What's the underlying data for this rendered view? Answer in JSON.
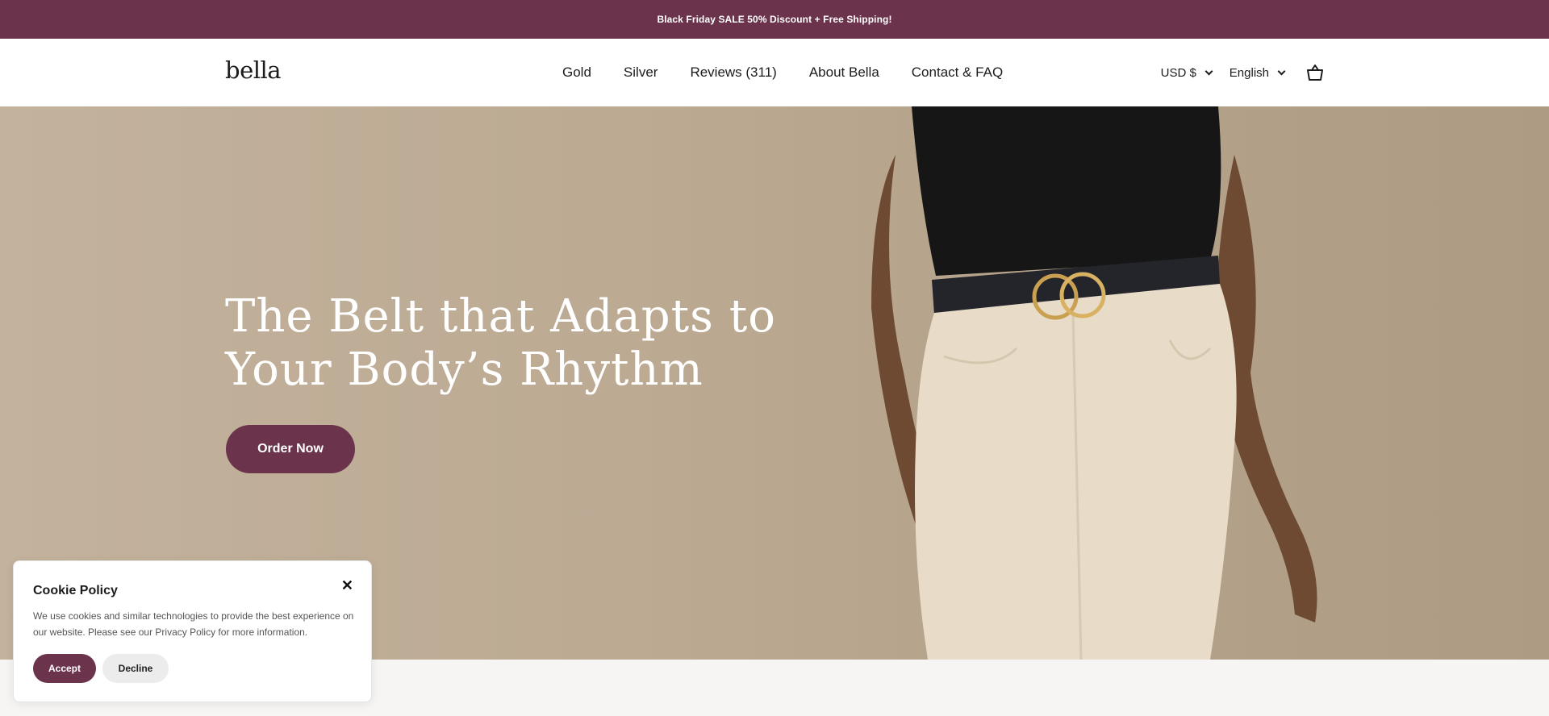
{
  "announcement": {
    "text": "Black Friday SALE 50% Discount + Free Shipping!"
  },
  "header": {
    "logo": "bella",
    "nav": [
      "Gold",
      "Silver",
      "Reviews (311)",
      "About Bella",
      "Contact & FAQ"
    ],
    "currency": "USD $",
    "language": "English",
    "cart_icon": "cart-icon"
  },
  "hero": {
    "title": "The Belt that Adapts to Your Body’s Rhythm",
    "cta": "Order Now"
  },
  "cookie": {
    "title": "Cookie Policy",
    "text": "We use cookies and similar technologies to provide the best experience on our website. Please see our Privacy Policy for more information.",
    "accept": "Accept",
    "decline": "Decline",
    "close_icon": "close-icon"
  },
  "colors": {
    "brand": "#6b344c",
    "hero_bg": "#bcaa93"
  }
}
